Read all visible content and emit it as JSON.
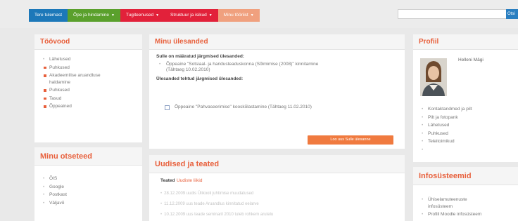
{
  "nav": {
    "items": [
      {
        "label": "Tere tulemast",
        "color": "#1c78b9",
        "chevron": false
      },
      {
        "label": "Õpe ja hindamine",
        "color": "#5aa02c",
        "chevron": true
      },
      {
        "label": "Tugiteenused",
        "color": "#e2213a",
        "chevron": true
      },
      {
        "label": "Struktuur ja isikud",
        "color": "#e2213a",
        "chevron": true
      },
      {
        "label": "Minu tööriist",
        "color": "#f0a07e",
        "chevron": true
      }
    ]
  },
  "search": {
    "placeholder": "",
    "button_label": "Otsi"
  },
  "left_panel_1": {
    "title": "Töövood",
    "items": [
      {
        "label": "Lähetused",
        "marker": "dot"
      },
      {
        "label": "Puhkused",
        "marker": "square"
      },
      {
        "label": "Akadeemilise aruandluse",
        "label2": "haldamine",
        "marker": "square"
      },
      {
        "label": "Puhkused",
        "marker": "square"
      },
      {
        "label": "Tasud",
        "marker": "square"
      },
      {
        "label": "Õppeained",
        "marker": "square"
      }
    ]
  },
  "left_panel_2": {
    "title": "Minu otsetеed",
    "items": [
      "ÕIS",
      "Google",
      "Postkast",
      "Väljavõ"
    ]
  },
  "tasks": {
    "title": "Minu ülesanded",
    "section1": "Sulle on määratud järgmised ülesanded:",
    "task1_line1": "Õppeaine \"Sotsiaal- ja haridusteaduskonna (Sõlmimise (2008)\" kinnitamine",
    "task1_line2": "(Tähtaeg 10.02.2010)",
    "section2": "Ülesanded tehtud järgmised ülesanded:",
    "task2": "Õppeaine \"Pahvaseerimise\" kooskõlastamine (Tähtaeg 11.02.2010)",
    "button": "Loo uus Sulle ülesanne"
  },
  "news": {
    "title": "Uudised ja teated",
    "label": "Teated",
    "link": "Uudiste liikid",
    "lines": [
      "28.12.2009 uudis Ülikooli juhtimise muudatused",
      "11.12.2009 uus teade Aruandlus kinnitatud eelarve",
      "10.12.2009 uus teade seminaril 2010 tuleb rohkem arutelu"
    ]
  },
  "profile": {
    "title": "Profiil",
    "name": "Helleni Mägi",
    "links": [
      "Kontaktandmed ja pilt",
      "Pilt ja fotopank",
      "Lähetused",
      "Puhkused",
      "Teleitoimikud"
    ]
  },
  "info": {
    "title": "Infosüsteemid",
    "item1_line1": "Ühiselamuteenuste",
    "item1_line2": "infosüsteem",
    "item2": "Profiil Moodle infosüsteem"
  }
}
